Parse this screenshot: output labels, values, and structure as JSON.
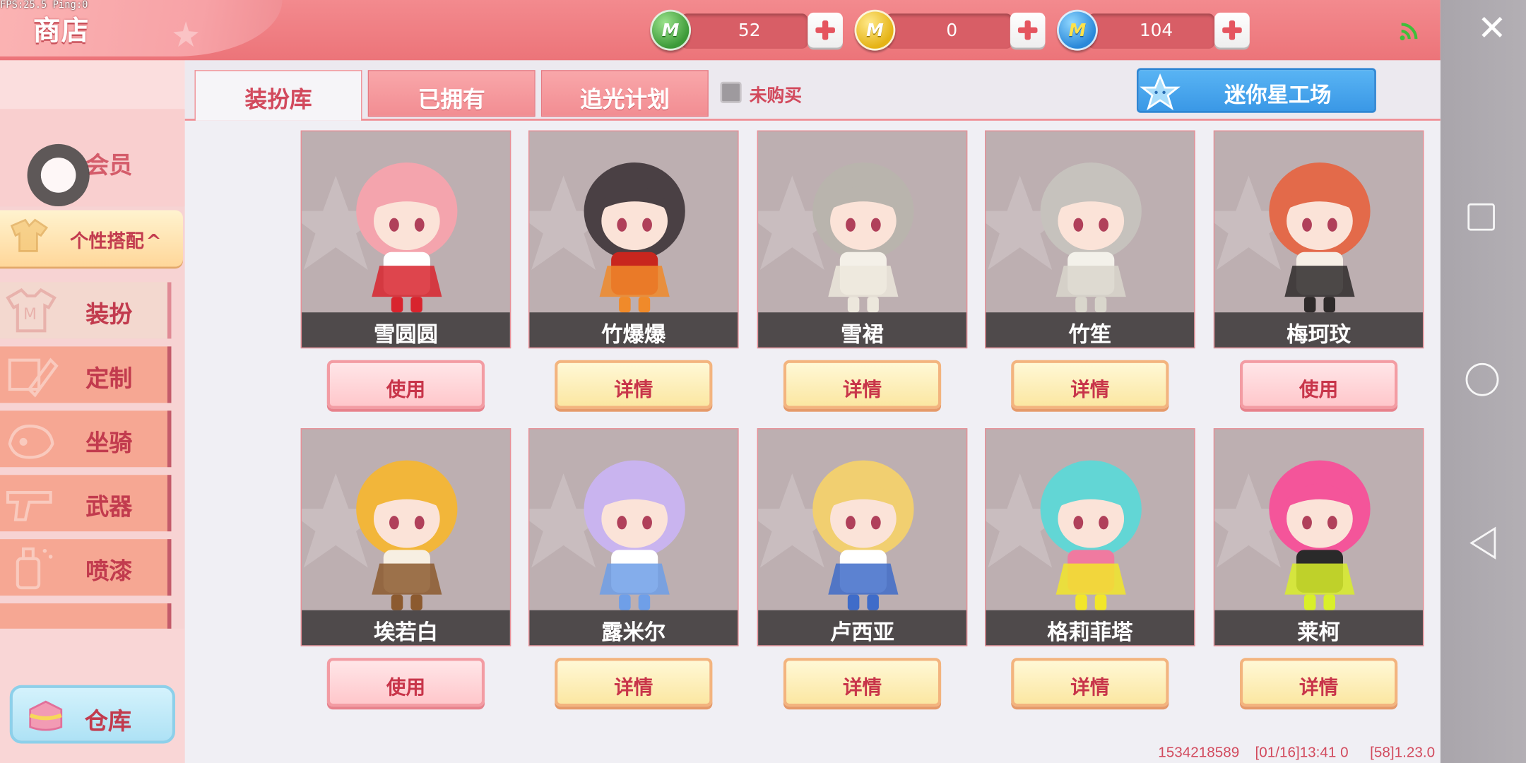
{
  "debug": {
    "fps": "FPS:25.5  Ping:0"
  },
  "header": {
    "title": "商店",
    "currencies": [
      {
        "icon": "green-mini-coin-icon",
        "glyph": "M",
        "value": "52"
      },
      {
        "icon": "gold-mini-coin-icon",
        "glyph": "M",
        "value": "0"
      },
      {
        "icon": "blue-mini-coin-icon",
        "glyph": "M",
        "value": "104"
      }
    ],
    "signal_icon": "wifi-signal-icon",
    "close_icon": "close-icon"
  },
  "sidebar": {
    "member_label": "会员",
    "style_header": "个性搭配",
    "style_header_arrow": "^",
    "categories": [
      {
        "label": "装扮",
        "icon": "shirt-icon",
        "active": true
      },
      {
        "label": "定制",
        "icon": "pencil-icon",
        "active": false
      },
      {
        "label": "坐骑",
        "icon": "mount-icon",
        "active": false
      },
      {
        "label": "武器",
        "icon": "gun-icon",
        "active": false
      },
      {
        "label": "喷漆",
        "icon": "spray-can-icon",
        "active": false
      }
    ],
    "warehouse_label": "仓库"
  },
  "tabs": [
    {
      "label": "装扮库",
      "active": true
    },
    {
      "label": "已拥有",
      "active": false
    },
    {
      "label": "追光计划",
      "active": false
    }
  ],
  "filter": {
    "label": "未购买",
    "checked": false
  },
  "studio_button": {
    "label": "迷你星工场",
    "icon": "star-icon"
  },
  "skins": [
    {
      "name": "雪圆圆",
      "action": "使用",
      "type": "use",
      "colors": [
        "#f4a4ad",
        "#ffffff",
        "#d8242e"
      ]
    },
    {
      "name": "竹爆爆",
      "action": "详情",
      "type": "detail",
      "colors": [
        "#4a4044",
        "#c8261e",
        "#f08a2a"
      ]
    },
    {
      "name": "雪裙",
      "action": "详情",
      "type": "detail",
      "colors": [
        "#b9b4ad",
        "#f4f0e8",
        "#ece7dc"
      ]
    },
    {
      "name": "竹笙",
      "action": "详情",
      "type": "detail",
      "colors": [
        "#c6c2bd",
        "#f3f1ea",
        "#d9d6cc"
      ]
    },
    {
      "name": "梅珂玟",
      "action": "使用",
      "type": "use",
      "colors": [
        "#e36a4a",
        "#f6efe6",
        "#2e2a2a"
      ]
    },
    {
      "name": "埃若白",
      "action": "使用",
      "type": "use",
      "colors": [
        "#f2b63a",
        "#f7efe2",
        "#8c5a2f"
      ]
    },
    {
      "name": "露米尔",
      "action": "详情",
      "type": "detail",
      "colors": [
        "#c9b4ef",
        "#ffffff",
        "#6f9fe8"
      ]
    },
    {
      "name": "卢西亚",
      "action": "详情",
      "type": "detail",
      "colors": [
        "#f1cf70",
        "#ffffff",
        "#3f6cc9"
      ]
    },
    {
      "name": "格莉菲塔",
      "action": "详情",
      "type": "detail",
      "colors": [
        "#62d6d5",
        "#f07aa0",
        "#f2e62a"
      ]
    },
    {
      "name": "莱柯",
      "action": "详情",
      "type": "detail",
      "colors": [
        "#f4559a",
        "#2a2a2a",
        "#d9ef2a"
      ]
    }
  ],
  "footer": {
    "uid": "1534218589",
    "time": "[01/16]13:41 0",
    "version": "[58]1.23.0"
  },
  "nav": {
    "recent": "recent-apps-icon",
    "home": "home-icon",
    "back": "back-icon"
  }
}
